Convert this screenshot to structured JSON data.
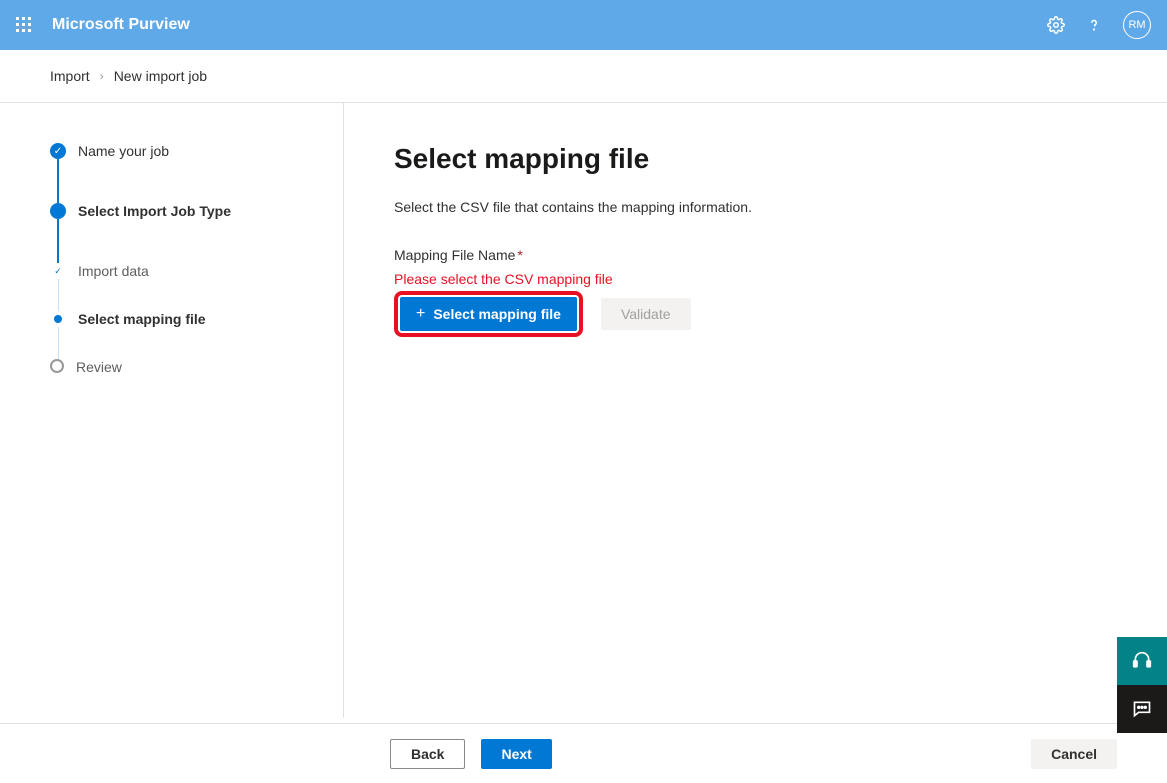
{
  "header": {
    "app_title": "Microsoft Purview",
    "avatar_initials": "RM"
  },
  "breadcrumb": {
    "root": "Import",
    "current": "New import job"
  },
  "steps": {
    "name_job": "Name your job",
    "select_type": "Select Import Job Type",
    "import_data": "Import data",
    "select_mapping": "Select mapping file",
    "review": "Review"
  },
  "main": {
    "heading": "Select mapping file",
    "description": "Select the CSV file that contains the mapping information.",
    "field_label": "Mapping File Name",
    "error_text": "Please select the CSV mapping file",
    "select_button": "Select mapping file",
    "validate_button": "Validate"
  },
  "footer": {
    "back": "Back",
    "next": "Next",
    "cancel": "Cancel"
  }
}
